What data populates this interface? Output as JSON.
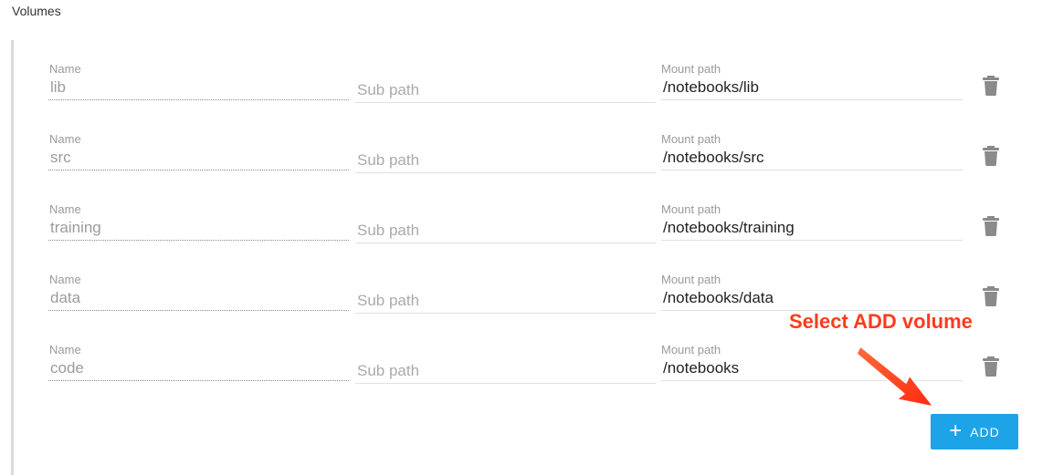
{
  "section": {
    "title": "Volumes"
  },
  "labels": {
    "name": "Name",
    "mount_path": "Mount path"
  },
  "sub_path_placeholder": "Sub path",
  "volumes": [
    {
      "name": "lib",
      "mount_path": "/notebooks/lib"
    },
    {
      "name": "src",
      "mount_path": "/notebooks/src"
    },
    {
      "name": "training",
      "mount_path": "/notebooks/training"
    },
    {
      "name": "data",
      "mount_path": "/notebooks/data"
    },
    {
      "name": "code",
      "mount_path": "/notebooks"
    }
  ],
  "add_button": {
    "label": "ADD",
    "icon": "plus-icon",
    "color": "#1ca3e8"
  },
  "annotation": {
    "text": "Select ADD volume",
    "color": "#ff3b1d"
  },
  "icons": {
    "delete": "trash-icon"
  }
}
